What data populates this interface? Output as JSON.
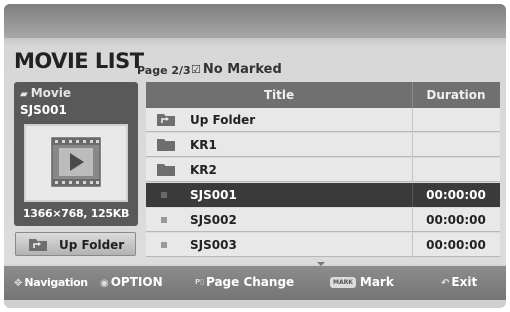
{
  "header": {
    "title": "MOVIE LIST",
    "page_indicator": "Page 2/3",
    "marked_status": "No Marked"
  },
  "preview": {
    "type_label": "Movie",
    "file_name": "SJS001",
    "info": "1366×768, 125KB",
    "thumbnail_icon": "film-play-icon"
  },
  "up_folder_button": {
    "label": "Up Folder",
    "icon": "folder-up-icon"
  },
  "table": {
    "columns": {
      "title": "Title",
      "duration": "Duration"
    },
    "rows": [
      {
        "name": "Up Folder",
        "duration": "",
        "kind": "up-folder"
      },
      {
        "name": "KR1",
        "duration": "",
        "kind": "folder"
      },
      {
        "name": "KR2",
        "duration": "",
        "kind": "folder"
      },
      {
        "name": "SJS001",
        "duration": "00:00:00",
        "kind": "movie",
        "selected": true
      },
      {
        "name": "SJS002",
        "duration": "00:00:00",
        "kind": "movie"
      },
      {
        "name": "SJS003",
        "duration": "00:00:00",
        "kind": "movie"
      }
    ]
  },
  "footer": {
    "navigation": "Navigation",
    "option": "OPTION",
    "page_change": "Page Change",
    "mark_key": "MARK",
    "mark": "Mark",
    "exit": "Exit"
  }
}
